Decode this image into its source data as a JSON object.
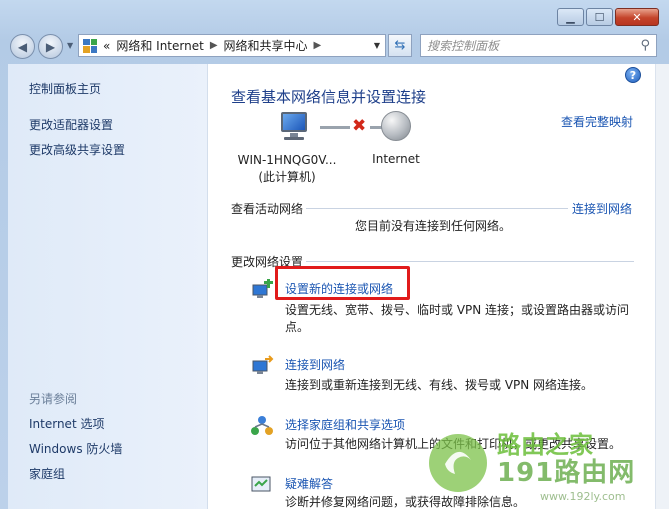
{
  "window": {
    "minimize": "▁",
    "maximize": "☐",
    "close": "✕"
  },
  "address": {
    "overflow": "«",
    "crumbs": [
      "网络和 Internet",
      "网络和共享中心"
    ],
    "search_placeholder": "搜索控制面板"
  },
  "sidebar": {
    "home": "控制面板主页",
    "links": [
      "更改适配器设置",
      "更改高级共享设置"
    ],
    "see_also_header": "另请参阅",
    "see_also": [
      "Internet 选项",
      "Windows 防火墙",
      "家庭组"
    ]
  },
  "main": {
    "title": "查看基本网络信息并设置连接",
    "full_map": "查看完整映射",
    "computer_name": "WIN-1HNQG0V...",
    "computer_sub": "(此计算机)",
    "internet_label": "Internet",
    "active_header": "查看活动网络",
    "connect_link": "连接到网络",
    "no_network": "您目前没有连接到任何网络。",
    "change_header": "更改网络设置",
    "tasks": [
      {
        "title": "设置新的连接或网络",
        "desc": "设置无线、宽带、拨号、临时或 VPN 连接；或设置路由器或访问点。"
      },
      {
        "title": "连接到网络",
        "desc": "连接到或重新连接到无线、有线、拨号或 VPN 网络连接。"
      },
      {
        "title": "选择家庭组和共享选项",
        "desc": "访问位于其他网络计算机上的文件和打印机，或更改共享设置。"
      },
      {
        "title": "疑难解答",
        "desc": "诊断并修复网络问题，或获得故障排除信息。"
      }
    ]
  },
  "watermark": {
    "line1": "路由之家",
    "line2": "191路由网",
    "url": "www.192ly.com"
  },
  "colors": {
    "link": "#1a55b2",
    "title": "#1e3f8a",
    "highlight": "#e11b1b"
  }
}
